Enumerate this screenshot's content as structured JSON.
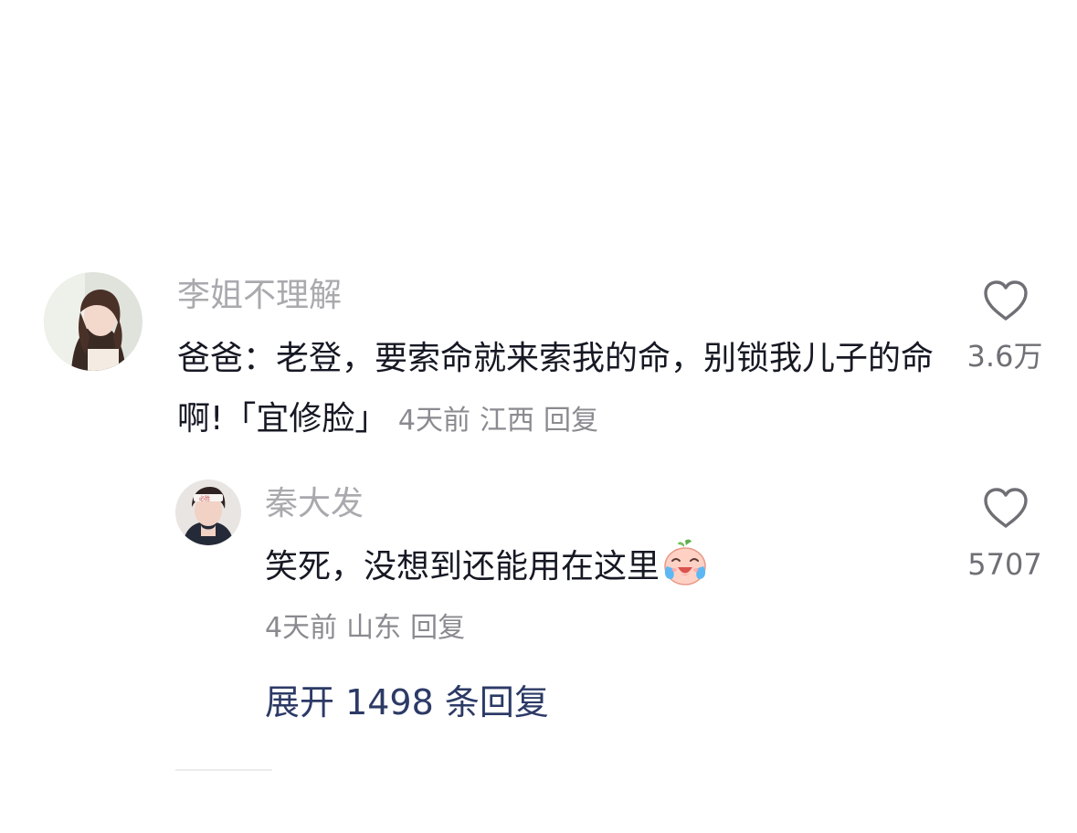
{
  "comment": {
    "username": "李姐不理解",
    "text": "爸爸：老登，要索命就来索我的命，别锁我儿子的命啊!「宜修脸」",
    "time": "4天前",
    "location": "江西",
    "reply_label": "回复",
    "like_count": "3.6万",
    "avatar_icon": "user-avatar-icon",
    "like_icon": "heart-outline-icon"
  },
  "reply": {
    "username": "秦大发",
    "text": "笑死，没想到还能用在这里",
    "emoji_icon": "laughing-crying-emoji-icon",
    "time": "4天前",
    "location": "山东",
    "reply_label": "回复",
    "like_count": "5707",
    "avatar_icon": "user-avatar-icon",
    "like_icon": "heart-outline-icon"
  },
  "expand_replies_label": "展开 1498 条回复",
  "colors": {
    "text": "#161823",
    "muted": "#a9a9ae",
    "meta": "#8a8a90",
    "link": "#2c3a66"
  }
}
